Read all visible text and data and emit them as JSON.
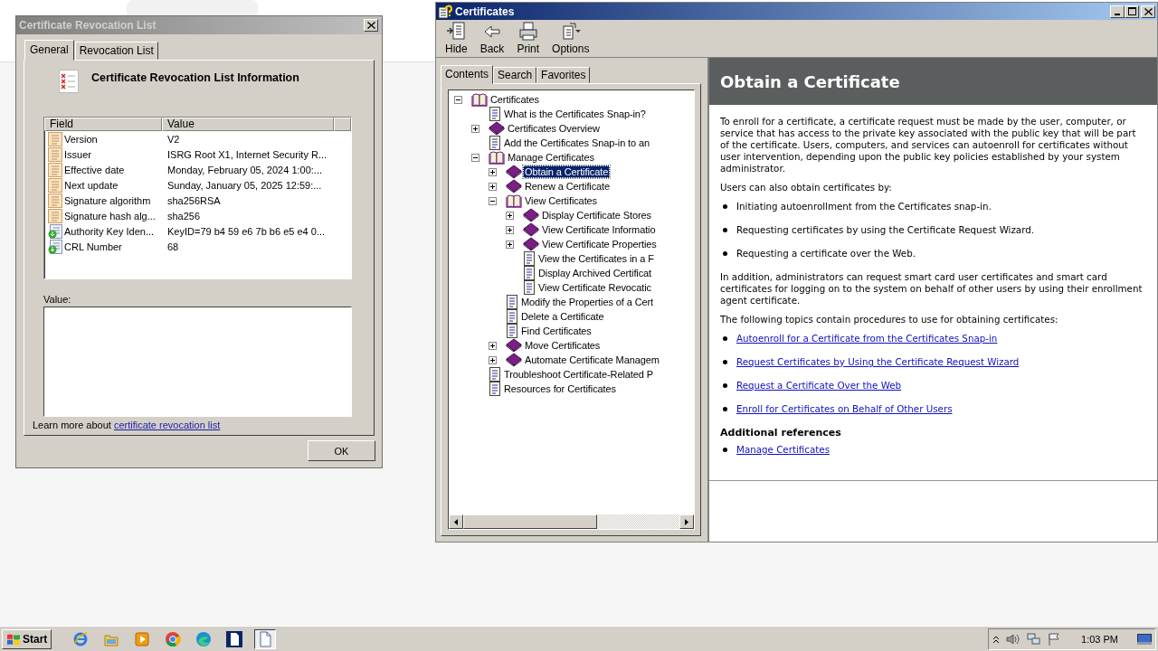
{
  "crl_dialog": {
    "title": "Certificate Revocation List",
    "tabs": [
      {
        "label": "General",
        "selected": true
      },
      {
        "label": "Revocation List",
        "selected": false
      }
    ],
    "heading": "Certificate Revocation List Information",
    "columns": [
      "Field",
      "Value"
    ],
    "fields": [
      {
        "kind": "property",
        "field": "Version",
        "value": "V2",
        "selected": false
      },
      {
        "kind": "property",
        "field": "Issuer",
        "value": "ISRG Root X1, Internet Security R...",
        "selected": false
      },
      {
        "kind": "property",
        "field": "Effective date",
        "value": "Monday, February 05, 2024 1:00:...",
        "selected": false
      },
      {
        "kind": "property",
        "field": "Next update",
        "value": "Sunday, January 05, 2025 12:59:...",
        "selected": false
      },
      {
        "kind": "property",
        "field": "Signature algorithm",
        "value": "sha256RSA",
        "selected": false
      },
      {
        "kind": "property",
        "field": "Signature hash alg...",
        "value": "sha256",
        "selected": false
      },
      {
        "kind": "extension",
        "field": "Authority Key Iden...",
        "value": "KeyID=79 b4 59 e6 7b b6 e5 e4 0...",
        "selected": false
      },
      {
        "kind": "extension",
        "field": "CRL Number",
        "value": "68",
        "selected": false
      }
    ],
    "value_label": "Value:",
    "learn_more": "Learn more about",
    "learn_more_link": "certificate revocation list",
    "ok_button": "OK"
  },
  "help_window": {
    "title": "Certificates",
    "toolbar": [
      {
        "kind": "hide",
        "label": "Hide"
      },
      {
        "kind": "back",
        "label": "Back"
      },
      {
        "kind": "print",
        "label": "Print"
      },
      {
        "kind": "options",
        "label": "Options"
      }
    ],
    "tabs": [
      {
        "label": "Contents",
        "selected": true
      },
      {
        "label": "Search",
        "selected": false
      },
      {
        "label": "Favorites",
        "selected": false
      }
    ],
    "tree": [
      {
        "label": "Certificates",
        "kind": "book",
        "expanded": true,
        "selected": false,
        "children": [
          {
            "label": "What is the Certificates Snap-in?",
            "kind": "page",
            "selected": false
          },
          {
            "label": "Certificates Overview",
            "kind": "book",
            "expanded": false,
            "selected": false
          },
          {
            "label": "Add the Certificates Snap-in to an",
            "kind": "page",
            "selected": false
          },
          {
            "label": "Manage Certificates",
            "kind": "book",
            "expanded": true,
            "selected": false,
            "children": [
              {
                "label": "Obtain a Certificate",
                "kind": "book",
                "expanded": false,
                "selected": true
              },
              {
                "label": "Renew a Certificate",
                "kind": "book",
                "expanded": false,
                "selected": false
              },
              {
                "label": "View Certificates",
                "kind": "book",
                "expanded": true,
                "selected": false,
                "children": [
                  {
                    "label": "Display Certificate Stores",
                    "kind": "book",
                    "expanded": false,
                    "selected": false
                  },
                  {
                    "label": "View Certificate Informatio",
                    "kind": "book",
                    "expanded": false,
                    "selected": false
                  },
                  {
                    "label": "View Certificate Properties",
                    "kind": "book",
                    "expanded": false,
                    "selected": false
                  },
                  {
                    "label": "View the Certificates in a F",
                    "kind": "page",
                    "selected": false
                  },
                  {
                    "label": "Display Archived Certificat",
                    "kind": "page",
                    "selected": false
                  },
                  {
                    "label": "View Certificate Revocatic",
                    "kind": "page",
                    "selected": false
                  }
                ]
              },
              {
                "label": "Modify the Properties of a Cert",
                "kind": "page",
                "selected": false
              },
              {
                "label": "Delete a Certificate",
                "kind": "page",
                "selected": false
              },
              {
                "label": "Find Certificates",
                "kind": "page",
                "selected": false
              },
              {
                "label": "Move Certificates",
                "kind": "book",
                "expanded": false,
                "selected": false
              },
              {
                "label": "Automate Certificate Managem",
                "kind": "book",
                "expanded": false,
                "selected": false
              }
            ]
          },
          {
            "label": "Troubleshoot Certificate-Related P",
            "kind": "page",
            "selected": false
          },
          {
            "label": "Resources for Certificates",
            "kind": "page",
            "selected": false
          }
        ]
      }
    ],
    "topic": {
      "title": "Obtain a Certificate",
      "blocks": [
        {
          "kind": "para",
          "text": "To enroll for a certificate, a certificate request must be made by the user, computer, or service that has access to the private key associated with the public key that will be part of the certificate. Users, computers, and services can autoenroll for certificates without user intervention, depending upon the public key policies established by your system administrator."
        },
        {
          "kind": "para",
          "text": "Users can also obtain certificates by:"
        },
        {
          "kind": "bullets",
          "items": [
            "Initiating autoenrollment from the Certificates snap-in.",
            "Requesting certificates by using the Certificate Request Wizard.",
            "Requesting a certificate over the Web."
          ]
        },
        {
          "kind": "para",
          "text": "In addition, administrators can request smart card user certificates and smart card certificates for logging on to the system on behalf of other users by using their enrollment agent certificate."
        },
        {
          "kind": "para",
          "text": "The following topics contain procedures to use for obtaining certificates:"
        },
        {
          "kind": "links",
          "items": [
            "Autoenroll for a Certificate from the Certificates Snap-in",
            "Request Certificates by Using the Certificate Request Wizard",
            "Request a Certificate Over the Web",
            "Enroll for Certificates on Behalf of Other Users"
          ]
        },
        {
          "kind": "heading",
          "text": "Additional references"
        },
        {
          "kind": "links",
          "items": [
            "Manage Certificates"
          ]
        }
      ]
    }
  },
  "taskbar": {
    "start": "Start",
    "apps": [
      {
        "kind": "ie",
        "selected": false
      },
      {
        "kind": "folder",
        "selected": false
      },
      {
        "kind": "media",
        "selected": false
      },
      {
        "kind": "chrome",
        "selected": false
      },
      {
        "kind": "edge",
        "selected": false
      },
      {
        "kind": "helpdoc",
        "selected": false
      },
      {
        "kind": "document",
        "selected": true
      }
    ],
    "clock": "1:03 PM"
  }
}
